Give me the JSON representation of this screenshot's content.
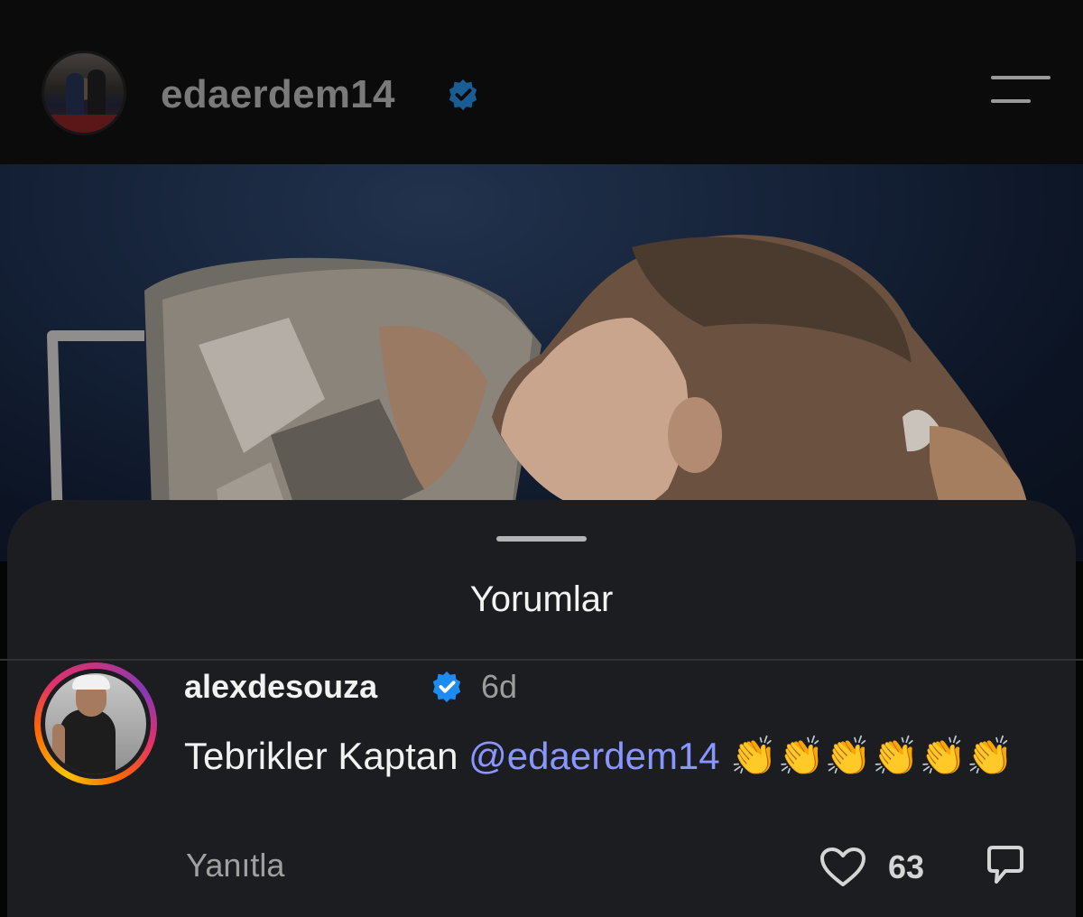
{
  "header": {
    "username": "edaerdem14",
    "verified": true
  },
  "comments_sheet": {
    "title": "Yorumlar"
  },
  "comment": {
    "username": "alexdesouza",
    "verified": true,
    "time": "6d",
    "text": "Tebrikler Kaptan",
    "mention": "@edaerdem14",
    "emoji": "👏👏👏👏👏👏",
    "reply_label": "Yanıtla",
    "like_count": "63"
  },
  "colors": {
    "verified_blue": "#1d8cf0",
    "mention": "#8a96ff",
    "sheet_bg": "#1c1d20"
  },
  "icons": [
    "verified-badge-icon",
    "menu-icon",
    "heart-icon",
    "share-icon"
  ]
}
